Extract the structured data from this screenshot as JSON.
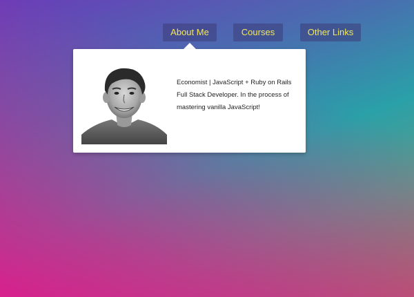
{
  "nav": {
    "items": [
      {
        "label": "About Me"
      },
      {
        "label": "Courses"
      },
      {
        "label": "Other Links"
      }
    ]
  },
  "about": {
    "bio": "Economist | JavaScript + Ruby on Rails Full Stack Developer. In the process of mastering vanilla JavaScript!",
    "photo_alt": "profile-photo"
  },
  "colors": {
    "nav_text": "#f2e85a",
    "nav_bg": "rgba(60,60,120,0.55)",
    "gradient_top": "#6a3db8",
    "gradient_mid": "#2aa0a8",
    "gradient_bottom_left": "#d8208c"
  }
}
